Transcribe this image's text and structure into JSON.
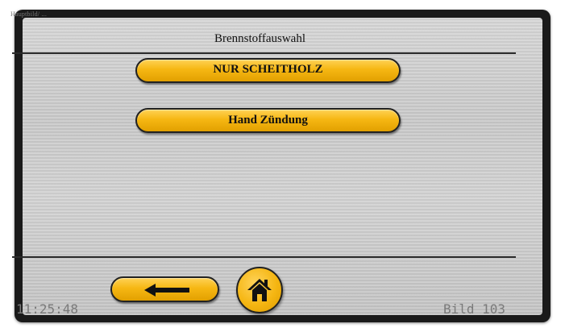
{
  "header": {
    "breadcrumb": "Hauptbild/ ...",
    "title": "Brennstoffauswahl"
  },
  "main": {
    "fuel_button_label": "NUR SCHEITHOLZ",
    "ignition_button_label": "Hand Zündung"
  },
  "footer": {
    "time": "11:25:48",
    "page_number": "Bild 103"
  },
  "icons": {
    "back": "arrow-left-icon",
    "home": "home-icon"
  },
  "colors": {
    "button_fill": "#f6b713",
    "button_border": "#222222",
    "background": "#cccccc",
    "frame": "#1a1a1a"
  }
}
